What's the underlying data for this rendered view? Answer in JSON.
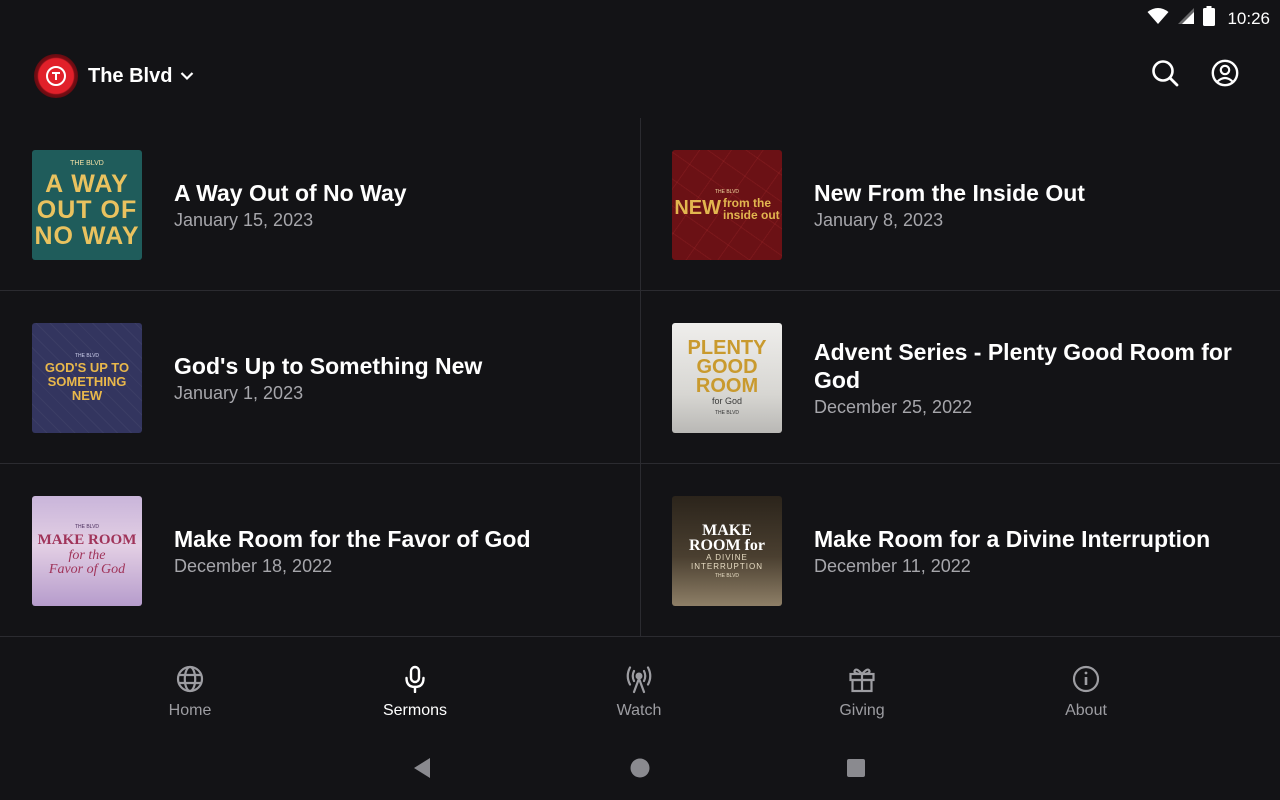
{
  "status_bar": {
    "time": "10:26"
  },
  "header": {
    "title": "The Blvd"
  },
  "sermons": [
    {
      "title": "A Way Out of No Way",
      "date": "January 15, 2023",
      "art": {
        "line1": "THE BLVD",
        "line2": "A WAY",
        "line3": "OUT OF",
        "line4": "NO WAY"
      }
    },
    {
      "title": "New From the Inside Out",
      "date": "January 8, 2023",
      "art": {
        "line1": "THE BLVD",
        "line2": "NEW",
        "line3": "from the",
        "line4": "inside out"
      }
    },
    {
      "title": "God's Up to Something New",
      "date": "January 1, 2023",
      "art": {
        "line1": "THE BLVD",
        "line2": "GOD'S UP TO",
        "line3": "SOMETHING NEW"
      }
    },
    {
      "title": "Advent Series - Plenty Good Room for God",
      "date": "December 25, 2022",
      "art": {
        "line1": "PLENTY",
        "line2": "GOOD",
        "line3": "ROOM",
        "line4": "for God",
        "line5": "THE BLVD"
      }
    },
    {
      "title": "Make Room for the Favor of God",
      "date": "December 18, 2022",
      "art": {
        "line1": "THE BLVD",
        "line2": "MAKE ROOM",
        "line3": "for the",
        "line4": "Favor of God"
      }
    },
    {
      "title": "Make Room for a Divine Interruption",
      "date": "December 11, 2022",
      "art": {
        "line1": "MAKE",
        "line2": "ROOM for",
        "line3": "A DIVINE",
        "line4": "INTERRUPTION",
        "line5": "THE BLVD"
      }
    }
  ],
  "bottom_nav": [
    {
      "label": "Home",
      "icon": "globe-icon"
    },
    {
      "label": "Sermons",
      "icon": "microphone-icon",
      "active": true
    },
    {
      "label": "Watch",
      "icon": "broadcast-icon"
    },
    {
      "label": "Giving",
      "icon": "gift-icon"
    },
    {
      "label": "About",
      "icon": "info-icon"
    }
  ],
  "colors": {
    "background": "#131316",
    "divider": "#2b2b30",
    "muted_text": "#a6a6ab",
    "brand_red": "#e1202a"
  }
}
